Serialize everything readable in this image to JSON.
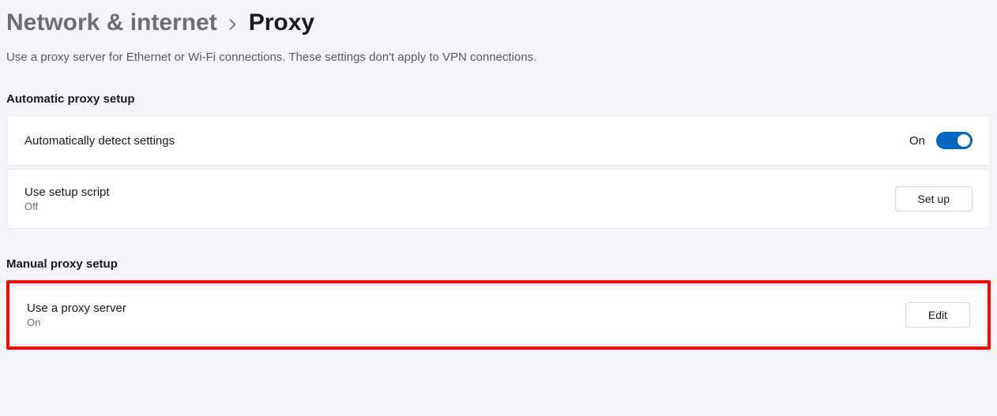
{
  "breadcrumb": {
    "parent": "Network & internet",
    "current": "Proxy"
  },
  "description": "Use a proxy server for Ethernet or Wi-Fi connections. These settings don't apply to VPN connections.",
  "automatic": {
    "header": "Automatic proxy setup",
    "detect": {
      "title": "Automatically detect settings",
      "state_label": "On"
    },
    "script": {
      "title": "Use setup script",
      "state_label": "Off",
      "button": "Set up"
    }
  },
  "manual": {
    "header": "Manual proxy setup",
    "proxy": {
      "title": "Use a proxy server",
      "state_label": "On",
      "button": "Edit"
    }
  }
}
